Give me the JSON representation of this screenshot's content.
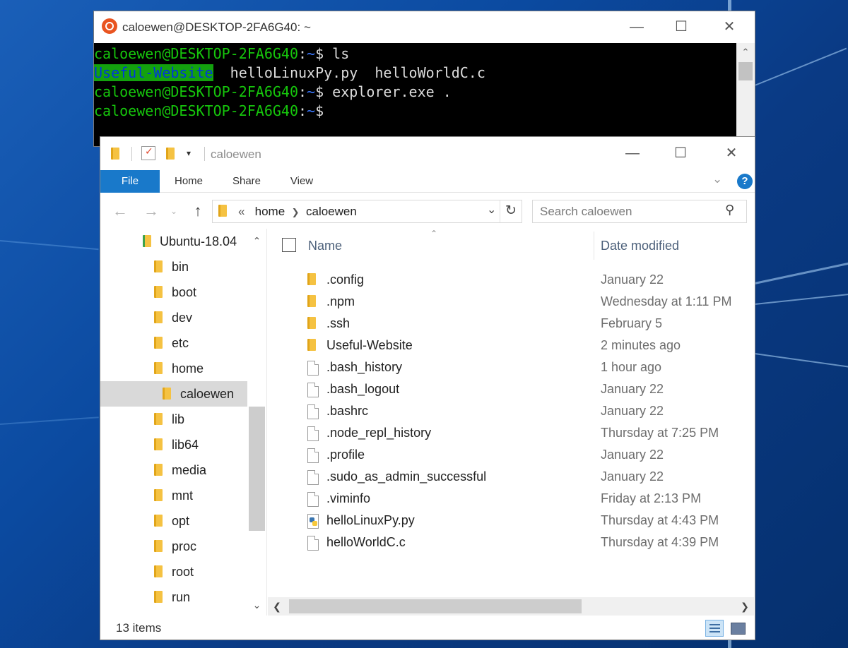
{
  "terminal": {
    "title": "caloewen@DESKTOP-2FA6G40: ~",
    "lines": [
      {
        "user": "caloewen@DESKTOP-2FA6G40",
        "sep": ":",
        "path": "~",
        "prompt": "$ ",
        "cmd": "ls"
      },
      {
        "dir": "Useful-Website",
        "files": "  helloLinuxPy.py  helloWorldC.c"
      },
      {
        "user": "caloewen@DESKTOP-2FA6G40",
        "sep": ":",
        "path": "~",
        "prompt": "$ ",
        "cmd": "explorer.exe ."
      },
      {
        "user": "caloewen@DESKTOP-2FA6G40",
        "sep": ":",
        "path": "~",
        "prompt": "$",
        "cmd": ""
      }
    ]
  },
  "explorer": {
    "title": "caloewen",
    "tabs": [
      "File",
      "Home",
      "Share",
      "View"
    ],
    "help_label": "?",
    "address": {
      "chevrons": "«",
      "crumbs": [
        "home",
        "caloewen"
      ]
    },
    "search": {
      "placeholder": "Search caloewen"
    },
    "nav_tree": [
      {
        "label": "Ubuntu-18.04",
        "level": 0
      },
      {
        "label": "bin",
        "level": 1
      },
      {
        "label": "boot",
        "level": 1
      },
      {
        "label": "dev",
        "level": 1
      },
      {
        "label": "etc",
        "level": 1
      },
      {
        "label": "home",
        "level": 1
      },
      {
        "label": "caloewen",
        "level": 2,
        "selected": true
      },
      {
        "label": "lib",
        "level": 1
      },
      {
        "label": "lib64",
        "level": 1
      },
      {
        "label": "media",
        "level": 1
      },
      {
        "label": "mnt",
        "level": 1
      },
      {
        "label": "opt",
        "level": 1
      },
      {
        "label": "proc",
        "level": 1
      },
      {
        "label": "root",
        "level": 1
      },
      {
        "label": "run",
        "level": 1
      }
    ],
    "columns": {
      "name": "Name",
      "date": "Date modified"
    },
    "files": [
      {
        "name": ".config",
        "date": "January 22",
        "type": "folder"
      },
      {
        "name": ".npm",
        "date": "Wednesday at 1:11 PM",
        "type": "folder"
      },
      {
        "name": ".ssh",
        "date": "February 5",
        "type": "folder"
      },
      {
        "name": "Useful-Website",
        "date": "2 minutes ago",
        "type": "folder"
      },
      {
        "name": ".bash_history",
        "date": "1 hour ago",
        "type": "file"
      },
      {
        "name": ".bash_logout",
        "date": "January 22",
        "type": "file"
      },
      {
        "name": ".bashrc",
        "date": "January 22",
        "type": "file"
      },
      {
        "name": ".node_repl_history",
        "date": "Thursday at 7:25 PM",
        "type": "file"
      },
      {
        "name": ".profile",
        "date": "January 22",
        "type": "file"
      },
      {
        "name": ".sudo_as_admin_successful",
        "date": "January 22",
        "type": "file"
      },
      {
        "name": ".viminfo",
        "date": "Friday at 2:13 PM",
        "type": "file"
      },
      {
        "name": "helloLinuxPy.py",
        "date": "Thursday at 4:43 PM",
        "type": "python"
      },
      {
        "name": "helloWorldC.c",
        "date": "Thursday at 4:39 PM",
        "type": "file"
      }
    ],
    "status": {
      "item_count": "13 items"
    }
  },
  "colors": {
    "terminal_user": "#16c60c",
    "terminal_path": "#3b78ff",
    "ribbon_file_tab": "#1979ca",
    "selected_tree_item": "#d9d9d9",
    "folder": "#f5c242"
  }
}
